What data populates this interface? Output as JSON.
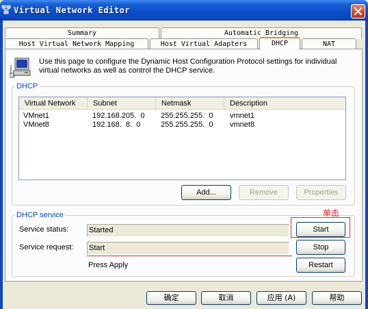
{
  "window": {
    "title": "Virtual Network Editor",
    "icon": "network-editor-icon",
    "close_icon": "close-icon"
  },
  "tabs": {
    "row1": [
      {
        "label": "Summary"
      },
      {
        "label": "Automatic Bridging"
      }
    ],
    "row2": [
      {
        "label": "Host Virtual Network Mapping"
      },
      {
        "label": "Host Virtual Adapters"
      },
      {
        "label": "DHCP",
        "active": true
      },
      {
        "label": "NAT"
      }
    ]
  },
  "intro": {
    "icon": "computer-icon",
    "text": "Use this page to configure the Dynamic Host Configuration Protocol settings for individual virtual networks as well as control the DHCP service."
  },
  "dhcp_group": {
    "label": "DHCP",
    "columns": [
      "Virtual Network",
      "Subnet",
      "Netmask",
      "Description"
    ],
    "rows": [
      [
        "VMnet1",
        "192.168.205.  0",
        "255.255.255.  0",
        "vmnet1"
      ],
      [
        "VMnet8",
        "192.168.  8.  0",
        "255.255.255.  0",
        "vmnet8"
      ]
    ],
    "buttons": {
      "add": "Add...",
      "remove": "Remove",
      "properties": "Properties"
    }
  },
  "service_group": {
    "label": "DHCP service",
    "status_label": "Service status:",
    "status_value": "Started",
    "request_label": "Service request:",
    "request_value": "Start",
    "apply_hint": "Press Apply",
    "buttons": {
      "start": "Start",
      "stop": "Stop",
      "restart": "Restart"
    },
    "annotation": "单击",
    "annotation_color": "#e02020"
  },
  "footer": {
    "ok": "确定",
    "cancel": "取消",
    "apply": "应用 (A)",
    "help": "帮助"
  },
  "colors": {
    "titlebar": "#0a4fcb",
    "active_tab_accent": "#e68b2c",
    "group_label": "#0046d5",
    "highlight": "#e03030"
  }
}
